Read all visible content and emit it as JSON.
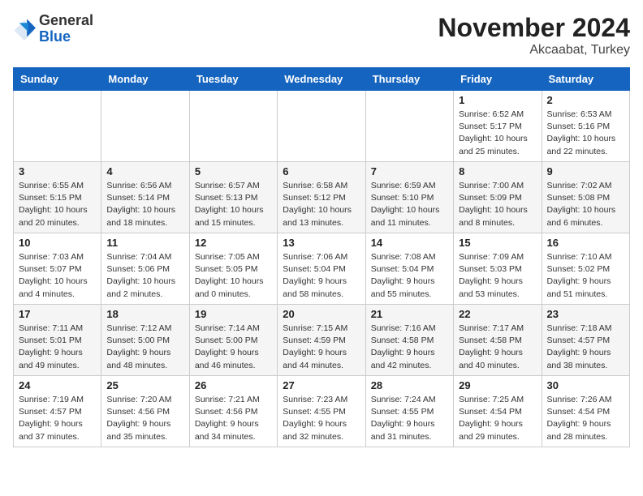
{
  "header": {
    "logo_line1": "General",
    "logo_line2": "Blue",
    "month_year": "November 2024",
    "location": "Akcaabat, Turkey"
  },
  "weekdays": [
    "Sunday",
    "Monday",
    "Tuesday",
    "Wednesday",
    "Thursday",
    "Friday",
    "Saturday"
  ],
  "weeks": [
    [
      {
        "day": "",
        "info": ""
      },
      {
        "day": "",
        "info": ""
      },
      {
        "day": "",
        "info": ""
      },
      {
        "day": "",
        "info": ""
      },
      {
        "day": "",
        "info": ""
      },
      {
        "day": "1",
        "info": "Sunrise: 6:52 AM\nSunset: 5:17 PM\nDaylight: 10 hours\nand 25 minutes."
      },
      {
        "day": "2",
        "info": "Sunrise: 6:53 AM\nSunset: 5:16 PM\nDaylight: 10 hours\nand 22 minutes."
      }
    ],
    [
      {
        "day": "3",
        "info": "Sunrise: 6:55 AM\nSunset: 5:15 PM\nDaylight: 10 hours\nand 20 minutes."
      },
      {
        "day": "4",
        "info": "Sunrise: 6:56 AM\nSunset: 5:14 PM\nDaylight: 10 hours\nand 18 minutes."
      },
      {
        "day": "5",
        "info": "Sunrise: 6:57 AM\nSunset: 5:13 PM\nDaylight: 10 hours\nand 15 minutes."
      },
      {
        "day": "6",
        "info": "Sunrise: 6:58 AM\nSunset: 5:12 PM\nDaylight: 10 hours\nand 13 minutes."
      },
      {
        "day": "7",
        "info": "Sunrise: 6:59 AM\nSunset: 5:10 PM\nDaylight: 10 hours\nand 11 minutes."
      },
      {
        "day": "8",
        "info": "Sunrise: 7:00 AM\nSunset: 5:09 PM\nDaylight: 10 hours\nand 8 minutes."
      },
      {
        "day": "9",
        "info": "Sunrise: 7:02 AM\nSunset: 5:08 PM\nDaylight: 10 hours\nand 6 minutes."
      }
    ],
    [
      {
        "day": "10",
        "info": "Sunrise: 7:03 AM\nSunset: 5:07 PM\nDaylight: 10 hours\nand 4 minutes."
      },
      {
        "day": "11",
        "info": "Sunrise: 7:04 AM\nSunset: 5:06 PM\nDaylight: 10 hours\nand 2 minutes."
      },
      {
        "day": "12",
        "info": "Sunrise: 7:05 AM\nSunset: 5:05 PM\nDaylight: 10 hours\nand 0 minutes."
      },
      {
        "day": "13",
        "info": "Sunrise: 7:06 AM\nSunset: 5:04 PM\nDaylight: 9 hours\nand 58 minutes."
      },
      {
        "day": "14",
        "info": "Sunrise: 7:08 AM\nSunset: 5:04 PM\nDaylight: 9 hours\nand 55 minutes."
      },
      {
        "day": "15",
        "info": "Sunrise: 7:09 AM\nSunset: 5:03 PM\nDaylight: 9 hours\nand 53 minutes."
      },
      {
        "day": "16",
        "info": "Sunrise: 7:10 AM\nSunset: 5:02 PM\nDaylight: 9 hours\nand 51 minutes."
      }
    ],
    [
      {
        "day": "17",
        "info": "Sunrise: 7:11 AM\nSunset: 5:01 PM\nDaylight: 9 hours\nand 49 minutes."
      },
      {
        "day": "18",
        "info": "Sunrise: 7:12 AM\nSunset: 5:00 PM\nDaylight: 9 hours\nand 48 minutes."
      },
      {
        "day": "19",
        "info": "Sunrise: 7:14 AM\nSunset: 5:00 PM\nDaylight: 9 hours\nand 46 minutes."
      },
      {
        "day": "20",
        "info": "Sunrise: 7:15 AM\nSunset: 4:59 PM\nDaylight: 9 hours\nand 44 minutes."
      },
      {
        "day": "21",
        "info": "Sunrise: 7:16 AM\nSunset: 4:58 PM\nDaylight: 9 hours\nand 42 minutes."
      },
      {
        "day": "22",
        "info": "Sunrise: 7:17 AM\nSunset: 4:58 PM\nDaylight: 9 hours\nand 40 minutes."
      },
      {
        "day": "23",
        "info": "Sunrise: 7:18 AM\nSunset: 4:57 PM\nDaylight: 9 hours\nand 38 minutes."
      }
    ],
    [
      {
        "day": "24",
        "info": "Sunrise: 7:19 AM\nSunset: 4:57 PM\nDaylight: 9 hours\nand 37 minutes."
      },
      {
        "day": "25",
        "info": "Sunrise: 7:20 AM\nSunset: 4:56 PM\nDaylight: 9 hours\nand 35 minutes."
      },
      {
        "day": "26",
        "info": "Sunrise: 7:21 AM\nSunset: 4:56 PM\nDaylight: 9 hours\nand 34 minutes."
      },
      {
        "day": "27",
        "info": "Sunrise: 7:23 AM\nSunset: 4:55 PM\nDaylight: 9 hours\nand 32 minutes."
      },
      {
        "day": "28",
        "info": "Sunrise: 7:24 AM\nSunset: 4:55 PM\nDaylight: 9 hours\nand 31 minutes."
      },
      {
        "day": "29",
        "info": "Sunrise: 7:25 AM\nSunset: 4:54 PM\nDaylight: 9 hours\nand 29 minutes."
      },
      {
        "day": "30",
        "info": "Sunrise: 7:26 AM\nSunset: 4:54 PM\nDaylight: 9 hours\nand 28 minutes."
      }
    ]
  ]
}
